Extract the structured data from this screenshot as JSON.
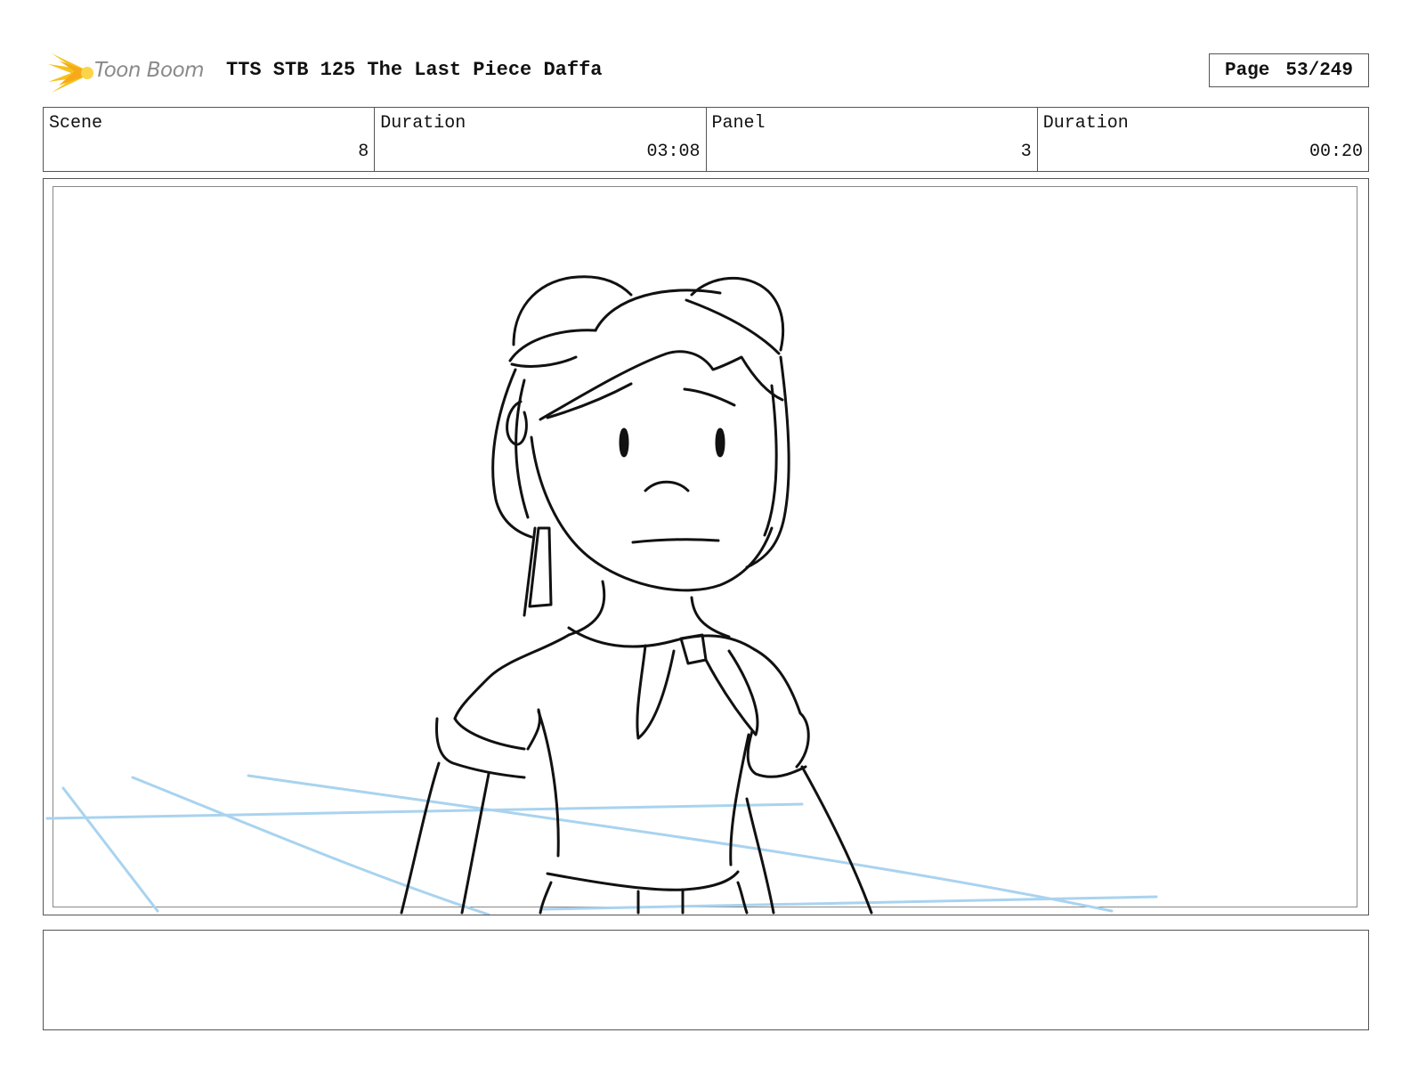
{
  "header": {
    "logo_text": "Toon Boom",
    "title": "TTS STB 125 The Last Piece Daffa",
    "page_label": "Page",
    "page_value": "53/249"
  },
  "info": {
    "scene_label": "Scene",
    "scene_value": "8",
    "scene_duration_label": "Duration",
    "scene_duration_value": "03:08",
    "panel_label": "Panel",
    "panel_value": "3",
    "panel_duration_label": "Duration",
    "panel_duration_value": "00:20"
  },
  "notes": {
    "text": ""
  },
  "colors": {
    "sketch_line": "#111111",
    "guide_line": "#a9d3ef",
    "logo_accent": "#f4c21a",
    "logo_text": "#8a8a8a"
  }
}
